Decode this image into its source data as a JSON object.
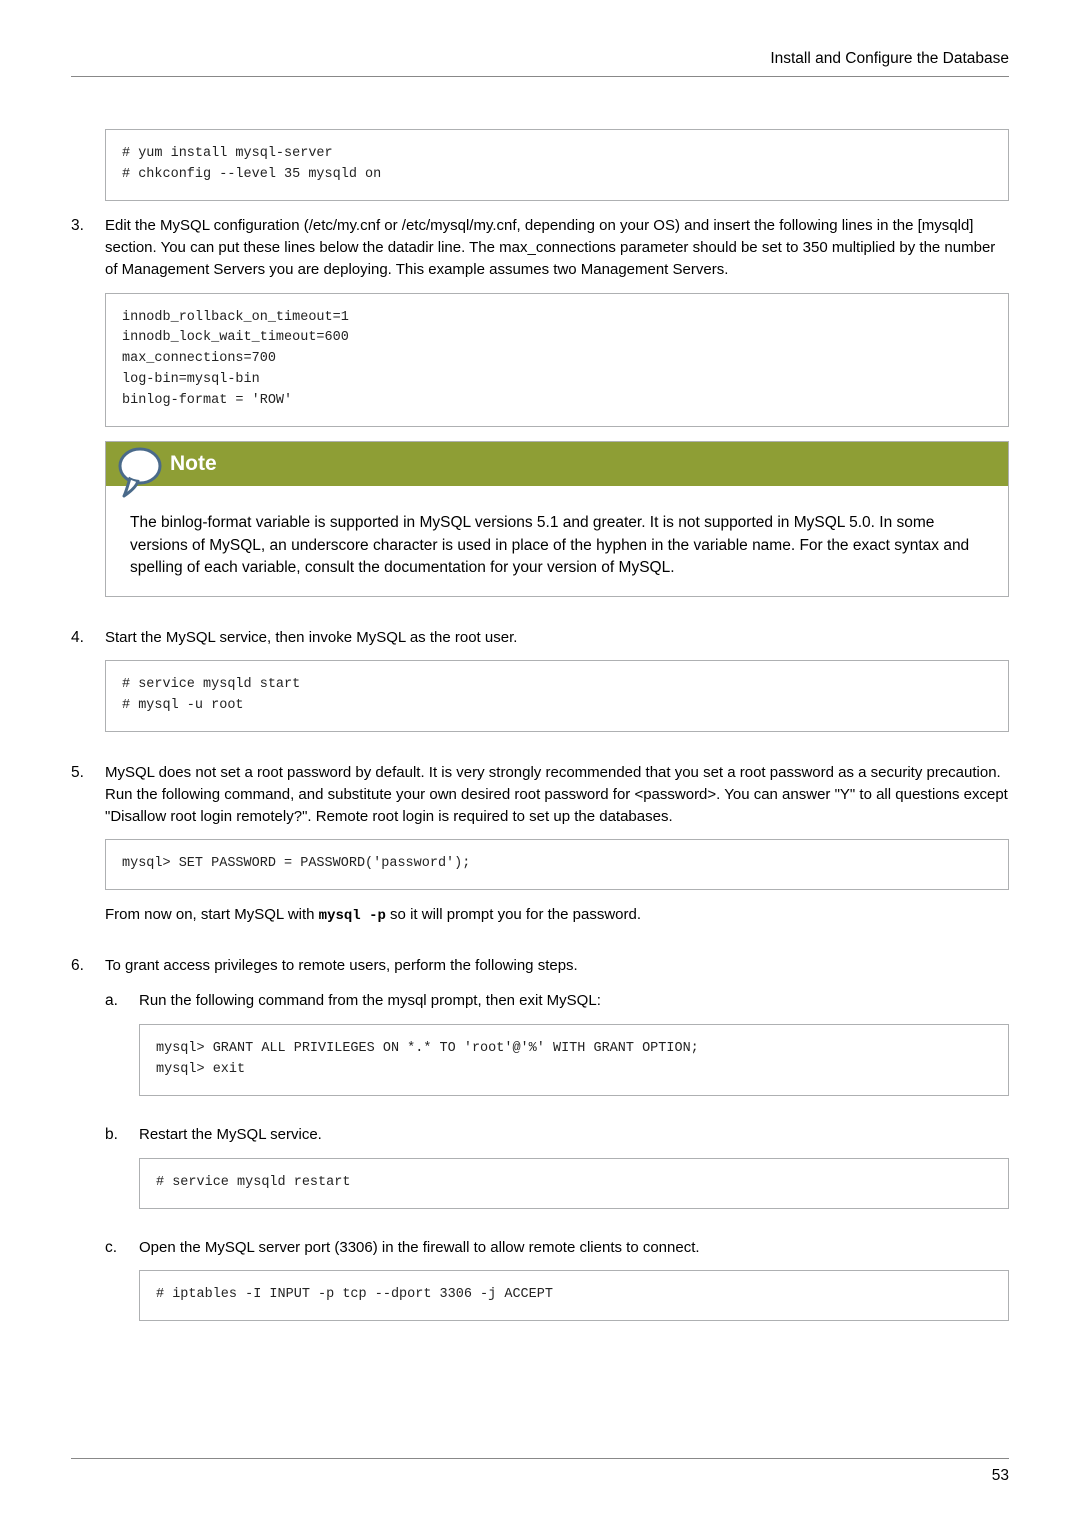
{
  "header": {
    "title": "Install and Configure the Database"
  },
  "steps": {
    "s2_code": "# yum install mysql-server\n# chkconfig --level 35 mysqld on",
    "s3": {
      "num": "3.",
      "text": "Edit the MySQL configuration (/etc/my.cnf or /etc/mysql/my.cnf, depending on your OS) and insert the following lines in the [mysqld] section. You can put these lines below the datadir line. The max_connections parameter should be set to 350 multiplied by the number of Management Servers you are deploying. This example assumes two Management Servers.",
      "code": "innodb_rollback_on_timeout=1\ninnodb_lock_wait_timeout=600\nmax_connections=700\nlog-bin=mysql-bin\nbinlog-format = 'ROW'",
      "note_label": "Note",
      "note_text": "The binlog-format variable is supported in MySQL versions 5.1 and greater. It is not supported in MySQL 5.0. In some versions of MySQL, an underscore character is used in place of the hyphen in the variable name. For the exact syntax and spelling of each variable, consult the documentation for your version of MySQL."
    },
    "s4": {
      "num": "4.",
      "text": "Start the MySQL service, then invoke MySQL as the root user.",
      "code": "# service mysqld start\n# mysql -u root"
    },
    "s5": {
      "num": "5.",
      "text": "MySQL does not set a root password by default. It is very strongly recommended that you set a root password as a security precaution. Run the following command, and substitute your own desired root password for <password>. You can answer \"Y\" to all questions except \"Disallow root login remotely?\". Remote root login is required to set up the databases.",
      "code": "mysql> SET PASSWORD = PASSWORD('password');",
      "after_pre": "From now on, start MySQL with ",
      "after_mono": "mysql -p",
      "after_post": " so it will prompt you for the password."
    },
    "s6": {
      "num": "6.",
      "text": "To grant access privileges to remote users, perform the following steps.",
      "a": {
        "let": "a.",
        "text": "Run the following command from the mysql prompt, then exit MySQL:",
        "code": "mysql> GRANT ALL PRIVILEGES ON *.* TO 'root'@'%' WITH GRANT OPTION;\nmysql> exit"
      },
      "b": {
        "let": "b.",
        "text": "Restart the MySQL service.",
        "code": "# service mysqld restart"
      },
      "c": {
        "let": "c.",
        "text": "Open the MySQL server port (3306) in the firewall to allow remote clients to connect.",
        "code": "# iptables -I INPUT -p tcp --dport 3306 -j ACCEPT"
      }
    }
  },
  "footer": {
    "page": "53"
  }
}
